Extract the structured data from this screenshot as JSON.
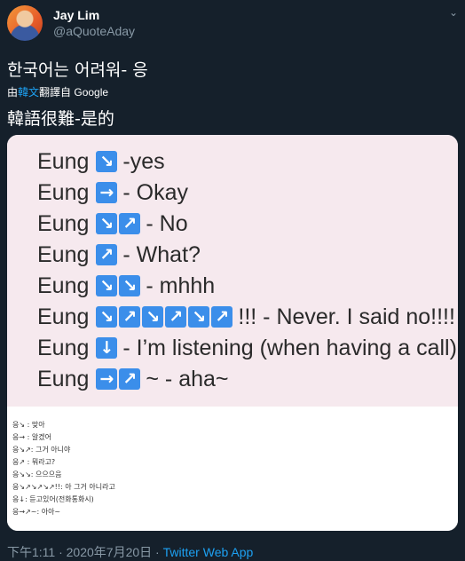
{
  "author": {
    "display_name": "Jay Lim",
    "handle": "@aQuoteAday"
  },
  "tweet": {
    "text": "한국어는 어려워- 응",
    "translated_prefix": "由",
    "translated_brand": "韓文",
    "translated_suffix": "翻譯自 Google",
    "translation": "韓語很難-是的"
  },
  "image_lines": [
    {
      "word": "Eung",
      "arrows": [
        "↘"
      ],
      "meaning": "-yes"
    },
    {
      "word": "Eung",
      "arrows": [
        "→"
      ],
      "meaning": "- Okay"
    },
    {
      "word": "Eung",
      "arrows": [
        "↘",
        "↗"
      ],
      "meaning": "- No"
    },
    {
      "word": "Eung",
      "arrows": [
        "↗"
      ],
      "meaning": "- What?"
    },
    {
      "word": "Eung",
      "arrows": [
        "↘",
        "↘"
      ],
      "meaning": "- mhhh"
    },
    {
      "word": "Eung",
      "arrows": [
        "↘",
        "↗",
        "↘",
        "↗",
        "↘",
        "↗"
      ],
      "meaning": "!!! - Never. I said no!!!!"
    },
    {
      "word": "Eung",
      "arrows": [
        "↓"
      ],
      "meaning": "- I’m listening (when having a call)"
    },
    {
      "word": "Eung",
      "arrows": [
        "→",
        "↗"
      ],
      "meaning": "~ - aha~"
    }
  ],
  "image_notes": [
    "응↘ : 맞아",
    "응→ : 알겠어",
    "응↘↗: 그거 아니야",
    "응↗ : 뭐라고?",
    "응↘↘: 으으으음",
    "응↘↗↘↗↘↗!!: 아 그거 아니라고",
    "응↓: 듣고있어(전화통화시)",
    "응→↗~: 아아~"
  ],
  "meta": {
    "timestamp": "下午1:11 · 2020年7月20日 · ",
    "app": "Twitter Web App"
  },
  "colors": {
    "background": "#15202b",
    "secondary_text": "#8899a6",
    "link": "#1da1f2",
    "arrow_box": "#3b8eea",
    "image_top_bg": "#f6e9ee"
  },
  "icons": {
    "more": "chevron-down-icon",
    "avatar": "avatar-image"
  }
}
